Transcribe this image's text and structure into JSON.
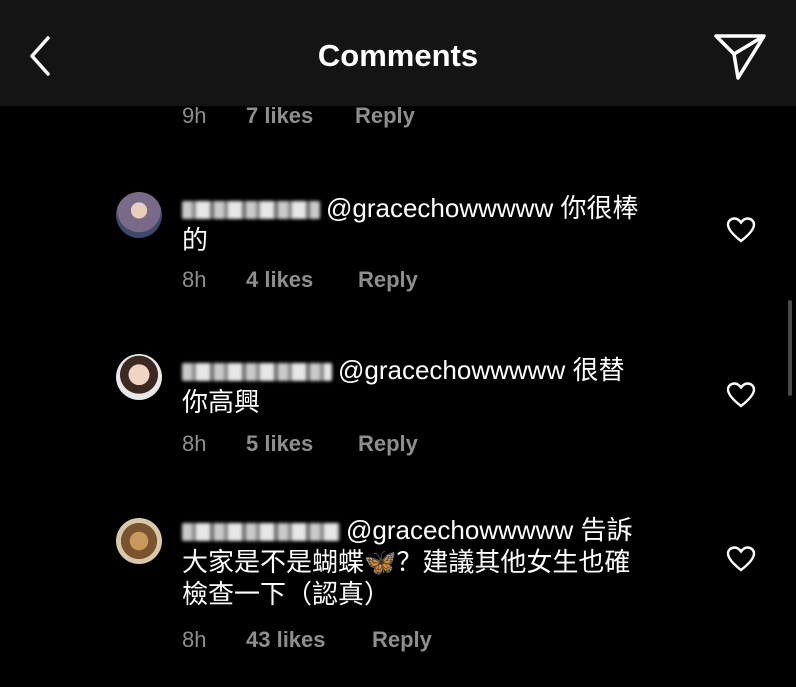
{
  "header": {
    "title": "Comments",
    "back_icon": "chevron-left-icon",
    "send_icon": "paper-plane-icon"
  },
  "top_meta": {
    "time": "9h",
    "likes": "7 likes",
    "reply": "Reply"
  },
  "comments": [
    {
      "mention": "@gracechowwwww",
      "text_line1": "你很棒",
      "text_line2": "的",
      "time": "8h",
      "likes": "4 likes",
      "reply": "Reply"
    },
    {
      "mention": "@gracechowwwww",
      "text_line1": "很替",
      "text_line2": "你高興",
      "time": "8h",
      "likes": "5 likes",
      "reply": "Reply"
    },
    {
      "mention": "@gracechowwwww",
      "text_line1": "告訴",
      "text_line2": "大家是不是蝴蝶🦋？建議其他女生也確",
      "text_line3": "檢查一下（認真）",
      "time": "8h",
      "likes": "43 likes",
      "reply": "Reply"
    }
  ],
  "colors": {
    "background": "#000000",
    "header": "#141414",
    "secondary_text": "#8e8e8e"
  }
}
